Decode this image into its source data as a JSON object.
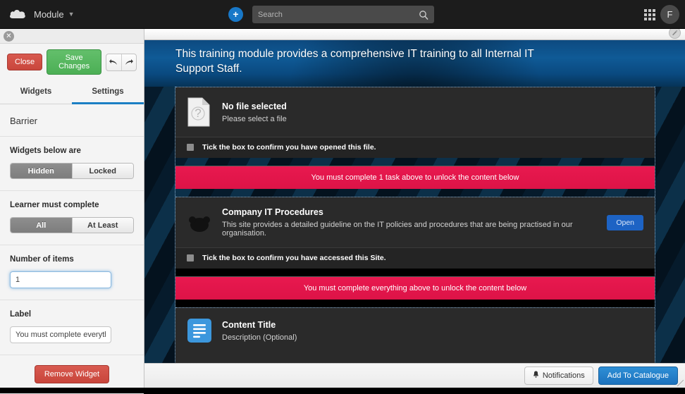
{
  "topnav": {
    "logo_icon": "cloud-logo-icon",
    "brand": "Module",
    "caret_icon": "chevron-down-icon",
    "plus_icon": "plus-icon",
    "search": {
      "value": "",
      "placeholder": "Search",
      "icon": "search-icon"
    },
    "apps_icon": "apps-grid-icon",
    "avatar_initial": "F"
  },
  "editor": {
    "close_x_icon": "close-icon",
    "buttons": {
      "close": "Close",
      "save": "Save Changes"
    },
    "undo_icon": "undo-arrow-icon",
    "redo_icon": "redo-arrow-icon",
    "tabs": [
      {
        "label": "Widgets",
        "active": false
      },
      {
        "label": "Settings",
        "active": true
      }
    ],
    "widget_title": "Barrier",
    "fields": [
      {
        "label": "Widgets below are",
        "type": "segmented",
        "options": [
          "Hidden",
          "Locked"
        ],
        "selected": "Hidden"
      },
      {
        "label": "Learner must complete",
        "type": "segmented",
        "options": [
          "All",
          "At Least"
        ],
        "selected": "All"
      },
      {
        "label": "Number of items",
        "type": "text",
        "value": "1",
        "focused": true
      },
      {
        "label": "Label",
        "type": "text",
        "value": "You must complete everything ab",
        "focused": false
      }
    ],
    "remove_button": "Remove Widget"
  },
  "main": {
    "edit_pencil_icon": "pencil-edit-icon",
    "hero_text": "This training module provides a comprehensive IT training to all Internal IT Support Staff.",
    "blocks": [
      {
        "kind": "card",
        "icon": "file-question-icon",
        "title": "No file selected",
        "description": "Please select a file",
        "tick_label": "Tick the box to confirm you have opened this file.",
        "tick_checked": false,
        "action": null
      },
      {
        "kind": "barrier",
        "text": "You must complete 1 task above to unlock the content below"
      },
      {
        "kind": "card",
        "icon": "website-globe-icon",
        "title": "Company IT Procedures",
        "description": "This site provides a detailed guideline on the IT policies and procedures that are being practised in our organisation.",
        "tick_label": "Tick the box to confirm you have accessed this Site.",
        "tick_checked": false,
        "action": "Open"
      },
      {
        "kind": "barrier",
        "text": "You must complete everything above to unlock the content below"
      },
      {
        "kind": "card",
        "icon": "document-blue-icon",
        "title": "Content Title",
        "description": "Description (Optional)",
        "tick_label": null,
        "tick_checked": false,
        "action": null
      }
    ]
  },
  "bottombar": {
    "notifications_label": "Notifications",
    "notifications_icon": "bell-icon",
    "catalogue_label": "Add To Catalogue"
  },
  "colors": {
    "accent_blue": "#1878c8",
    "barrier_red": "#e8194f",
    "save_green": "#4caf55",
    "danger_red": "#c8453b",
    "hero_blue": "#0f5a96"
  }
}
